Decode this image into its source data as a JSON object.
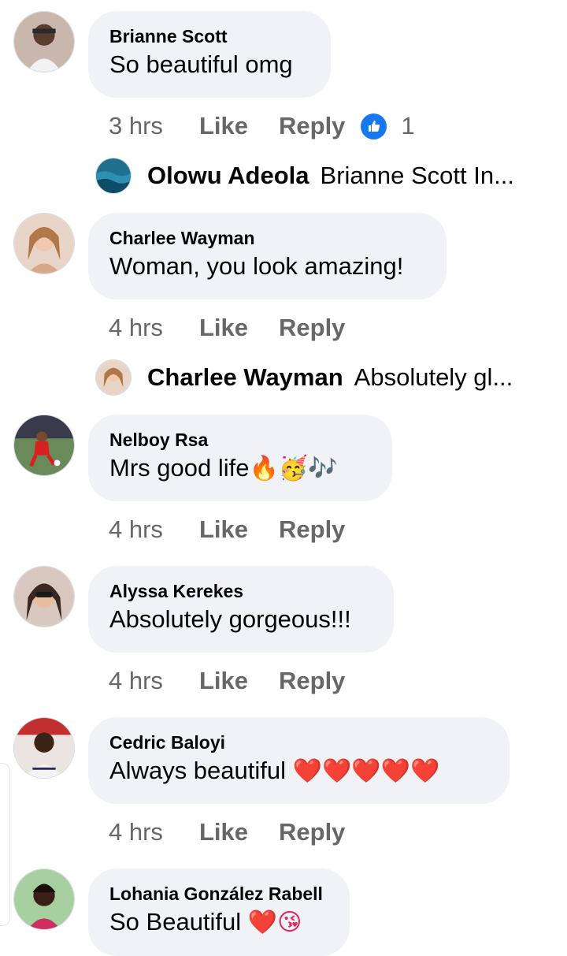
{
  "comments": [
    {
      "author": "Brianne Scott",
      "text": "So beautiful omg",
      "time": "3 hrs",
      "like": "Like",
      "reply": "Reply",
      "reactions": "1",
      "reaction_icon": "thumbs-up-icon"
    },
    {
      "author": "Charlee Wayman",
      "text": "Woman, you look amazing!",
      "time": "4 hrs",
      "like": "Like",
      "reply": "Reply"
    },
    {
      "author": "Nelboy Rsa",
      "text": "Mrs good life",
      "emojis": "🔥🥳🎶",
      "time": "4 hrs",
      "like": "Like",
      "reply": "Reply"
    },
    {
      "author": "Alyssa Kerekes",
      "text": "Absolutely gorgeous!!!",
      "time": "4 hrs",
      "like": "Like",
      "reply": "Reply"
    },
    {
      "author": "Cedric Baloyi",
      "text": "Always beautiful ",
      "emojis": "❤️❤️❤️❤️❤️",
      "time": "4 hrs",
      "like": "Like",
      "reply": "Reply"
    },
    {
      "author": "Lohania González Rabell",
      "text": "So Beautiful ",
      "emojis": "❤️😘"
    }
  ],
  "reply_previews": [
    {
      "author": "Olowu Adeola",
      "text": "Brianne Scott In..."
    },
    {
      "author": "Charlee Wayman",
      "text": "Absolutely gl..."
    }
  ],
  "colors": {
    "bubble": "#f0f2f5",
    "secondary_text": "#65676b",
    "like_blue": "#1877f2",
    "heart_red": "#e0245e"
  }
}
